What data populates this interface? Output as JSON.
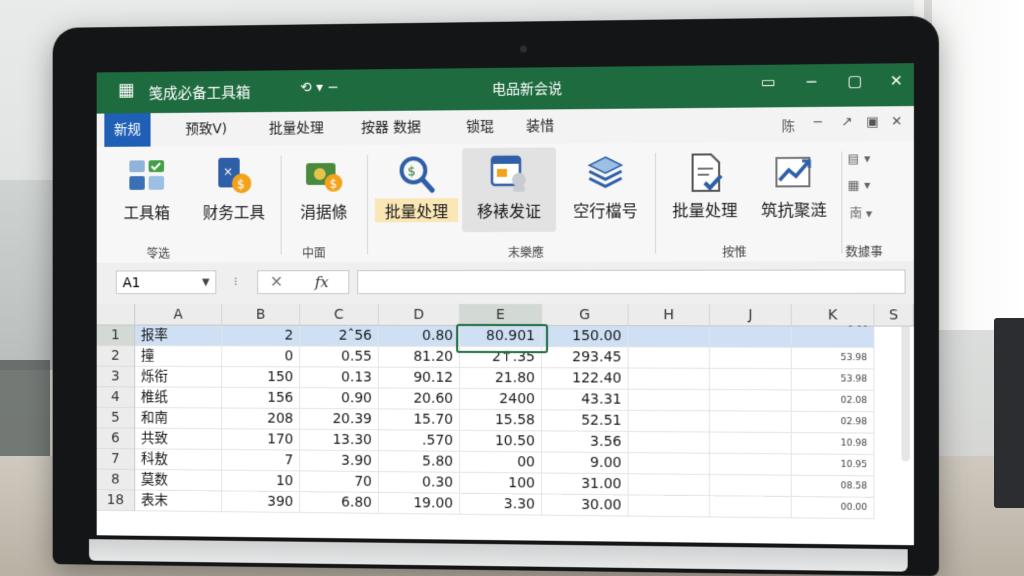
{
  "app": {
    "title": "笺成必备工具箱",
    "quick_access": "⟲ ▾ −",
    "document_title": "电品新会说"
  },
  "window_controls": [
    "▭",
    "−",
    "▢",
    "✕"
  ],
  "tabs": [
    {
      "label": "新规",
      "active": true
    },
    {
      "label": "预致V)",
      "active": false
    },
    {
      "label": "批量处理",
      "active": false
    },
    {
      "label": "按器  数据",
      "active": false
    },
    {
      "label": "锁琨",
      "active": false
    },
    {
      "label": "装惜",
      "active": false
    }
  ],
  "tabs_right": [
    "陈",
    "−",
    "↗",
    "▣",
    "✕"
  ],
  "ribbon": {
    "buttons": [
      {
        "label": "工具箱",
        "icon": "toolbox-grid-icon"
      },
      {
        "label": "财务工具",
        "icon": "finance-calculator-icon"
      },
      {
        "label": "涓据條",
        "icon": "money-stack-icon"
      },
      {
        "label": "批量处理",
        "icon": "search-magnifier-icon",
        "highlight": true
      },
      {
        "label": "移裱发证",
        "icon": "document-user-icon",
        "selected": true
      },
      {
        "label": "空行檔号",
        "icon": "layers-stack-icon"
      },
      {
        "label": "批量处理",
        "icon": "document-check-icon"
      },
      {
        "label": "筑抗聚涟",
        "icon": "trend-chart-icon"
      }
    ],
    "mini_items": [
      "▾",
      "▾",
      "南 ▾"
    ],
    "groups": [
      "笭选",
      "中面",
      "末樂應",
      "按惟",
      "数據事"
    ]
  },
  "formula_bar": {
    "name_box": "A1",
    "cancel_symbol": "✕",
    "fx_symbol": "fx",
    "formula": ""
  },
  "grid": {
    "columns": [
      "A",
      "B",
      "C",
      "D",
      "E",
      "G",
      "H",
      "J",
      "K",
      "S"
    ],
    "selected_column": "E",
    "k_header_note": "0·00",
    "rows": [
      {
        "num": "1",
        "cells": [
          "报率",
          "2",
          "2ˆ56",
          "0.80",
          "80.901",
          "150.00",
          "",
          "",
          ""
        ]
      },
      {
        "num": "2",
        "cells": [
          "撞",
          "0",
          "0.55",
          "81.20",
          "2↑.35",
          "293.45",
          "",
          "",
          "53.98"
        ]
      },
      {
        "num": "3",
        "cells": [
          "烁衔",
          "150",
          "0.13",
          "90.12",
          "21.80",
          "122.40",
          "",
          "",
          "53.98"
        ]
      },
      {
        "num": "4",
        "cells": [
          "椎纸",
          "156",
          "0.90",
          "20.60",
          "2400",
          "43.31",
          "",
          "",
          "02.08"
        ]
      },
      {
        "num": "5",
        "cells": [
          "和南",
          "208",
          "20.39",
          "15.70",
          "15.58",
          "52.51",
          "",
          "",
          "02.98"
        ]
      },
      {
        "num": "6",
        "cells": [
          "共致",
          "170",
          "13.30",
          ".570",
          "10.50",
          "3.56",
          "",
          "",
          "10.98"
        ]
      },
      {
        "num": "7",
        "cells": [
          "科敖",
          "7",
          "3.90",
          "5.80",
          "00",
          "9.00",
          "",
          "",
          "10.95"
        ]
      },
      {
        "num": "8",
        "cells": [
          "莫数",
          "10",
          "70",
          "0.30",
          "100",
          "31.00",
          "",
          "",
          "08.58"
        ]
      },
      {
        "num": "18",
        "cells": [
          "表末",
          "390",
          "6.80",
          "19.00",
          "3.30",
          "30.00",
          "",
          "",
          "00.00"
        ]
      }
    ]
  }
}
